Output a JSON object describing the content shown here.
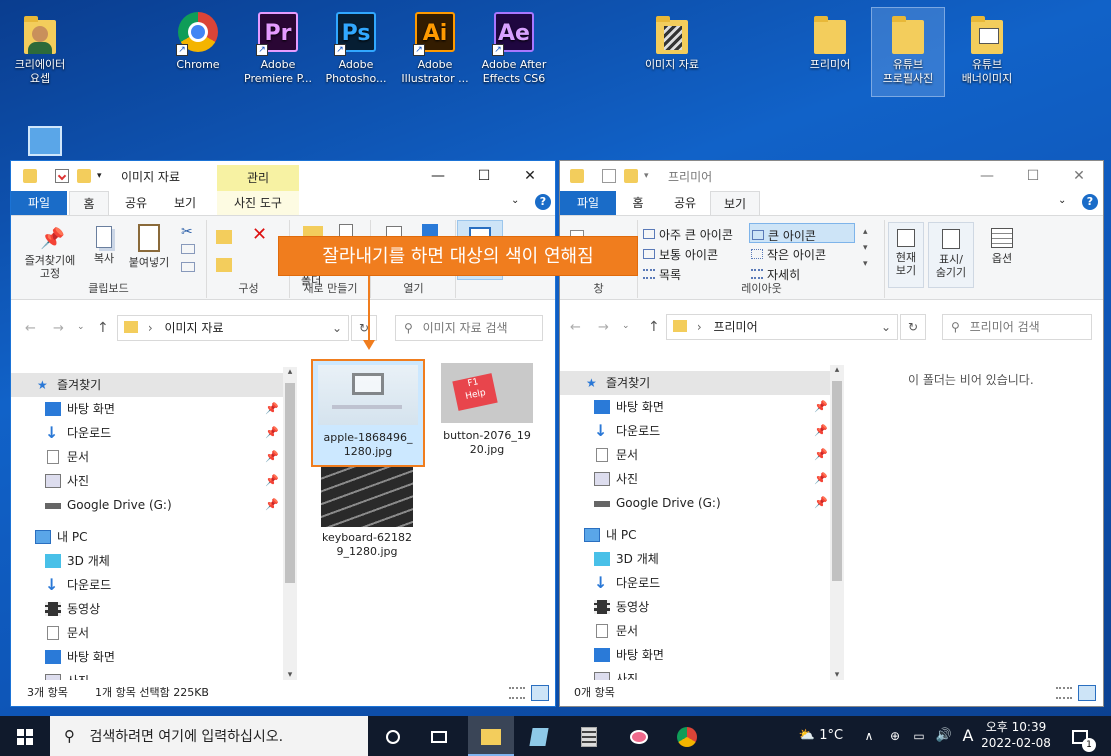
{
  "desktop": {
    "icons": [
      {
        "label": "크리에이터\n요셉"
      },
      {
        "label": "Chrome"
      },
      {
        "label": "Adobe\nPremiere P...",
        "text": "Pr"
      },
      {
        "label": "Adobe\nPhotosho...",
        "text": "Ps"
      },
      {
        "label": "Adobe\nIllustrator ...",
        "text": "Ai"
      },
      {
        "label": "Adobe After\nEffects CS6",
        "text": "Ae"
      },
      {
        "label": "이미지 자료"
      },
      {
        "label": "프리미어"
      },
      {
        "label": "유튜브\n프로필사진"
      },
      {
        "label": "유튜브\n배너이미지"
      }
    ]
  },
  "left_window": {
    "title": "이미지 자료",
    "context_tab": "관리",
    "tabs": [
      "파일",
      "홈",
      "공유",
      "보기",
      "사진 도구"
    ],
    "ribbon": {
      "pin_label": "즐겨찾기에\n고정",
      "copy_label": "복사",
      "paste_label": "붙여넣기",
      "clipboard_group": "클립보드",
      "organize_group": "구성",
      "new_folder_partial": "폴더",
      "new_group": "새로 만들기",
      "open_group": "열기"
    },
    "address": {
      "path": "이미지 자료",
      "search_placeholder": "이미지 자료 검색"
    },
    "nav": {
      "quick_access": "즐겨찾기",
      "quick_items": [
        "바탕 화면",
        "다운로드",
        "문서",
        "사진",
        "Google Drive (G:)"
      ],
      "this_pc": "내 PC",
      "pc_items": [
        "3D 개체",
        "다운로드",
        "동영상",
        "문서",
        "바탕 화면",
        "사진"
      ]
    },
    "files": [
      {
        "name": "apple-1868496_\n1280.jpg",
        "selected": true
      },
      {
        "name": "button-2076_19\n20.jpg",
        "selected": false
      },
      {
        "name": "keyboard-62182\n9_1280.jpg",
        "selected": false
      }
    ],
    "status": {
      "count": "3개 항목",
      "selection": "1개 항목 선택함 225KB"
    }
  },
  "right_window": {
    "title": "프리미어",
    "tabs": [
      "파일",
      "홈",
      "공유",
      "보기"
    ],
    "ribbon": {
      "layouts": [
        "아주 큰 아이콘",
        "큰 아이콘",
        "보통 아이콘",
        "작은 아이콘",
        "목록",
        "자세히"
      ],
      "pane_group": "창",
      "layout_group": "레이아웃",
      "current_view": "현재\n보기",
      "show_hide": "표시/\n숨기기",
      "options": "옵션"
    },
    "address": {
      "path": "프리미어",
      "search_placeholder": "프리미어 검색"
    },
    "empty_message": "이 폴더는 비어 있습니다.",
    "nav": {
      "quick_access": "즐겨찾기",
      "quick_items": [
        "바탕 화면",
        "다운로드",
        "문서",
        "사진",
        "Google Drive (G:)"
      ],
      "this_pc": "내 PC",
      "pc_items": [
        "3D 개체",
        "다운로드",
        "동영상",
        "문서",
        "바탕 화면",
        "사진"
      ]
    },
    "status": {
      "count": "0개 항목"
    }
  },
  "callout": {
    "text": "잘라내기를 하면 대상의 색이 연해짐",
    "color": "#f07d1e"
  },
  "taskbar": {
    "search_placeholder": "검색하려면 여기에 입력하십시오.",
    "weather": "1°C",
    "ime": "A",
    "time": "오후 10:39",
    "date": "2022-02-08",
    "notification_count": "1"
  }
}
